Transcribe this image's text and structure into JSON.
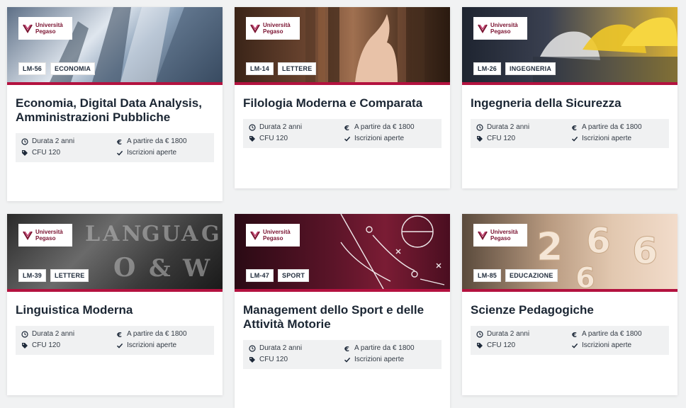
{
  "logo": {
    "line1": "Università",
    "line2": "Pegaso"
  },
  "cards": [
    {
      "code": "LM-56",
      "area": "ECONOMIA",
      "title": "Economia, Digital Data Analysis, Amministrazioni Pubbliche",
      "durata": "Durata 2 anni",
      "prezzo": "A partire da € 1800",
      "cfu": "CFU 120",
      "iscrizioni": "Iscrizioni aperte"
    },
    {
      "code": "LM-14",
      "area": "LETTERE",
      "title": "Filologia Moderna e Comparata",
      "durata": "Durata 2 anni",
      "prezzo": "A partire da € 1800",
      "cfu": "CFU 120",
      "iscrizioni": "Iscrizioni aperte"
    },
    {
      "code": "LM-26",
      "area": "INGEGNERIA",
      "title": "Ingegneria della Sicurezza",
      "durata": "Durata 2 anni",
      "prezzo": "A partire da € 1800",
      "cfu": "CFU 120",
      "iscrizioni": "Iscrizioni aperte"
    },
    {
      "code": "LM-39",
      "area": "LETTERE",
      "title": "Linguistica Moderna",
      "durata": "Durata 2 anni",
      "prezzo": "A partire da € 1800",
      "cfu": "CFU 120",
      "iscrizioni": "Iscrizioni aperte"
    },
    {
      "code": "LM-47",
      "area": "SPORT",
      "title": "Management dello Sport e delle Attività Motorie",
      "durata": "Durata 2 anni",
      "prezzo": "A partire da € 1800",
      "cfu": "CFU 120",
      "iscrizioni": "Iscrizioni aperte"
    },
    {
      "code": "LM-85",
      "area": "EDUCAZIONE",
      "title": "Scienze Pedagogiche",
      "durata": "Durata 2 anni",
      "prezzo": "A partire da € 1800",
      "cfu": "CFU 120",
      "iscrizioni": "Iscrizioni aperte"
    }
  ],
  "colors": {
    "accent": "#b3123f",
    "brand": "#7a1230",
    "info_bg": "#f0f1f2",
    "title": "#1b2633"
  },
  "icons": [
    "clock-icon",
    "euro-icon",
    "tag-icon",
    "check-icon"
  ]
}
